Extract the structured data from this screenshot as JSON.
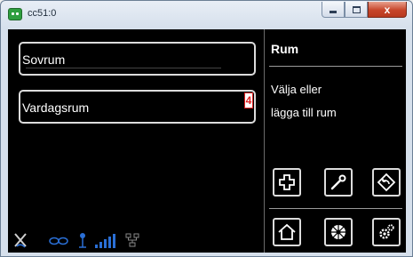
{
  "window": {
    "title": "cc51:0",
    "minimize_icon": "minimize-icon",
    "maximize_icon": "maximize-icon",
    "close_label": "x"
  },
  "rooms": [
    {
      "label": "Sovrum"
    },
    {
      "label": "Vardagsrum",
      "badge": "4"
    }
  ],
  "panel": {
    "title": "Rum",
    "line1": "Välja eller",
    "line2": "lägga till rum"
  },
  "toolbar_top": [
    "add-icon",
    "wrench-icon",
    "back-icon"
  ],
  "toolbar_bottom": [
    "home-icon",
    "fan-icon",
    "settings-icon"
  ],
  "status_icons": [
    "tools-icon",
    "link-icon",
    "antenna-icon",
    "signal-icon",
    "network-icon"
  ],
  "colors": {
    "background": "#000000",
    "border": "#dcdcdc",
    "badge": "#e02020",
    "status_blue": "#2a6fd6"
  }
}
